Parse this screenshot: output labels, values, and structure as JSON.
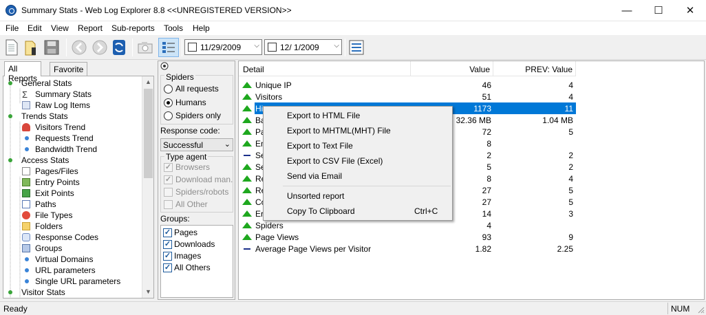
{
  "window": {
    "title": "Summary Stats - Web Log Explorer 8.8 <<UNREGISTERED VERSION>>",
    "minimize": "—",
    "maximize": "☐",
    "close": "✕"
  },
  "menu": [
    "File",
    "Edit",
    "View",
    "Report",
    "Sub-reports",
    "Tools",
    "Help"
  ],
  "toolbar": {
    "date_from": "11/29/2009",
    "date_to": "12/  1/2009"
  },
  "left_tabs": [
    "All Reports",
    "Favorite"
  ],
  "tree": [
    {
      "label": "General Stats",
      "icon": "bullet-green-icon"
    },
    {
      "label": "Summary Stats",
      "icon": "sigma-icon"
    },
    {
      "label": "Raw Log Items",
      "icon": "table-icon"
    },
    {
      "label": "Trends Stats",
      "icon": "bullet-green-icon"
    },
    {
      "label": "Visitors Trend",
      "icon": "user-icon"
    },
    {
      "label": "Requests Trend",
      "icon": "bullet-blue-icon"
    },
    {
      "label": "Bandwidth Trend",
      "icon": "bullet-blue-icon"
    },
    {
      "label": "Access Stats",
      "icon": "bullet-green-icon"
    },
    {
      "label": "Pages/Files",
      "icon": "page-icon"
    },
    {
      "label": "Entry Points",
      "icon": "entry-icon"
    },
    {
      "label": "Exit Points",
      "icon": "exit-icon"
    },
    {
      "label": "Paths",
      "icon": "paths-icon"
    },
    {
      "label": "File Types",
      "icon": "filetypes-icon"
    },
    {
      "label": "Folders",
      "icon": "folder-icon"
    },
    {
      "label": "Response Codes",
      "icon": "response-icon"
    },
    {
      "label": "Groups",
      "icon": "groups-icon"
    },
    {
      "label": "Virtual Domains",
      "icon": "bullet-blue-icon"
    },
    {
      "label": "URL parameters",
      "icon": "bullet-blue-icon"
    },
    {
      "label": "Single URL parameters",
      "icon": "bullet-blue-icon"
    },
    {
      "label": "Visitor Stats",
      "icon": "bullet-green-icon"
    }
  ],
  "filters": {
    "spiders_label": "Spiders",
    "spider_options": [
      "All requests",
      "Humans",
      "Spiders only"
    ],
    "spider_selected": "Humans",
    "response_label": "Response code:",
    "response_value": "Successful",
    "type_agent_label": "Type agent",
    "agent_options": [
      "Browsers",
      "Download man.",
      "Spiders/robots",
      "All Other"
    ],
    "groups_label": "Groups:",
    "groups": [
      "Pages",
      "Downloads",
      "Images",
      "All Others"
    ]
  },
  "grid": {
    "headers": {
      "detail": "Detail",
      "value": "Value",
      "prev": "PREV: Value"
    },
    "rows": [
      {
        "detail": "Unique IP",
        "value": "46",
        "prev": "4",
        "trend": "up"
      },
      {
        "detail": "Visitors",
        "value": "51",
        "prev": "4",
        "trend": "up"
      },
      {
        "detail": "Hi",
        "value": "1173",
        "prev": "11",
        "trend": "up"
      },
      {
        "detail": "Ba",
        "value": "32.36 MB",
        "prev": "1.04 MB",
        "trend": "up"
      },
      {
        "detail": "Pa",
        "value": "72",
        "prev": "5",
        "trend": "up"
      },
      {
        "detail": "En",
        "value": "8",
        "prev": "",
        "trend": "up"
      },
      {
        "detail": "Se",
        "value": "2",
        "prev": "2",
        "trend": "same"
      },
      {
        "detail": "Se",
        "value": "5",
        "prev": "2",
        "trend": "up"
      },
      {
        "detail": "Re",
        "value": "8",
        "prev": "4",
        "trend": "up"
      },
      {
        "detail": "Re",
        "value": "27",
        "prev": "5",
        "trend": "up"
      },
      {
        "detail": "Co",
        "value": "27",
        "prev": "5",
        "trend": "up"
      },
      {
        "detail": "Er",
        "value": "14",
        "prev": "3",
        "trend": "up"
      },
      {
        "detail": "Spiders",
        "value": "4",
        "prev": "",
        "trend": "up"
      },
      {
        "detail": "Page Views",
        "value": "93",
        "prev": "9",
        "trend": "up"
      },
      {
        "detail": "Average Page Views per Visitor",
        "value": "1.82",
        "prev": "2.25",
        "trend": "same"
      }
    ]
  },
  "context_menu": [
    {
      "label": "Export to HTML File",
      "shortcut": ""
    },
    {
      "label": "Export to MHTML(MHT) File",
      "shortcut": ""
    },
    {
      "label": "Export to Text File",
      "shortcut": ""
    },
    {
      "label": "Export to CSV File (Excel)",
      "shortcut": ""
    },
    {
      "label": "Send via Email",
      "shortcut": ""
    },
    {
      "label": "Unsorted report",
      "shortcut": ""
    },
    {
      "label": "Copy To Clipboard",
      "shortcut": "Ctrl+C"
    }
  ],
  "status": {
    "text": "Ready",
    "num": "NUM"
  },
  "colors": {
    "selection": "#0078d7",
    "up_arrow": "#1ea81e",
    "same_dash": "#1a2f8a"
  }
}
